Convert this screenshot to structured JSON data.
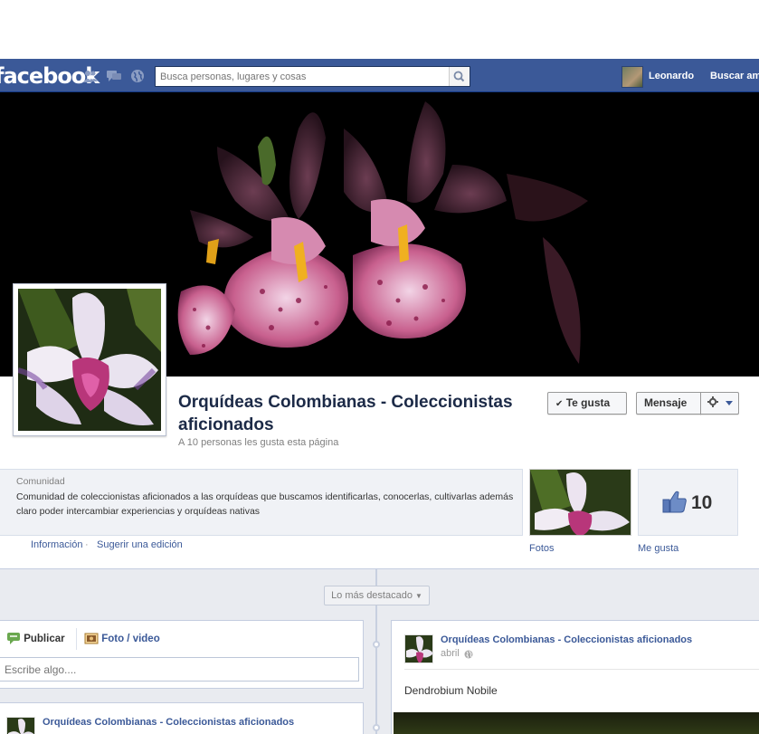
{
  "topbar": {
    "logo": "facebook",
    "search_placeholder": "Busca personas, lugares y cosas",
    "user_name": "Leonardo",
    "find_friends": "Buscar am",
    "colors": {
      "bar": "#3b5998",
      "text": "#ffffff"
    }
  },
  "page": {
    "title": "Orquídeas Colombianas - Coleccionistas aficionados",
    "likes_text": "A 10 personas les gusta esta página",
    "like_button": "Te gusta",
    "message_button": "Mensaje"
  },
  "about": {
    "category": "Comunidad",
    "description": "Comunidad de coleccionistas aficionados a las orquídeas que buscamos identificarlas, conocerlas, cultivarlas además claro poder intercambiar experiencias y orquídeas nativas",
    "info_link": "Información",
    "separator": "·",
    "suggest_link": "Sugerir una edición"
  },
  "apps": {
    "photos_label": "Fotos",
    "likes_label": "Me gusta",
    "likes_count": "10"
  },
  "timeline": {
    "highlights": "Lo más destacado",
    "composer": {
      "publish_tab": "Publicar",
      "photo_tab": "Foto / video",
      "placeholder": "Escribe algo...."
    },
    "post_left": {
      "author": "Orquídeas Colombianas - Coleccionistas aficionados"
    },
    "post_right": {
      "author": "Orquídeas Colombianas - Coleccionistas aficionados",
      "date": "abril",
      "text": "Dendrobium Nobile"
    }
  }
}
